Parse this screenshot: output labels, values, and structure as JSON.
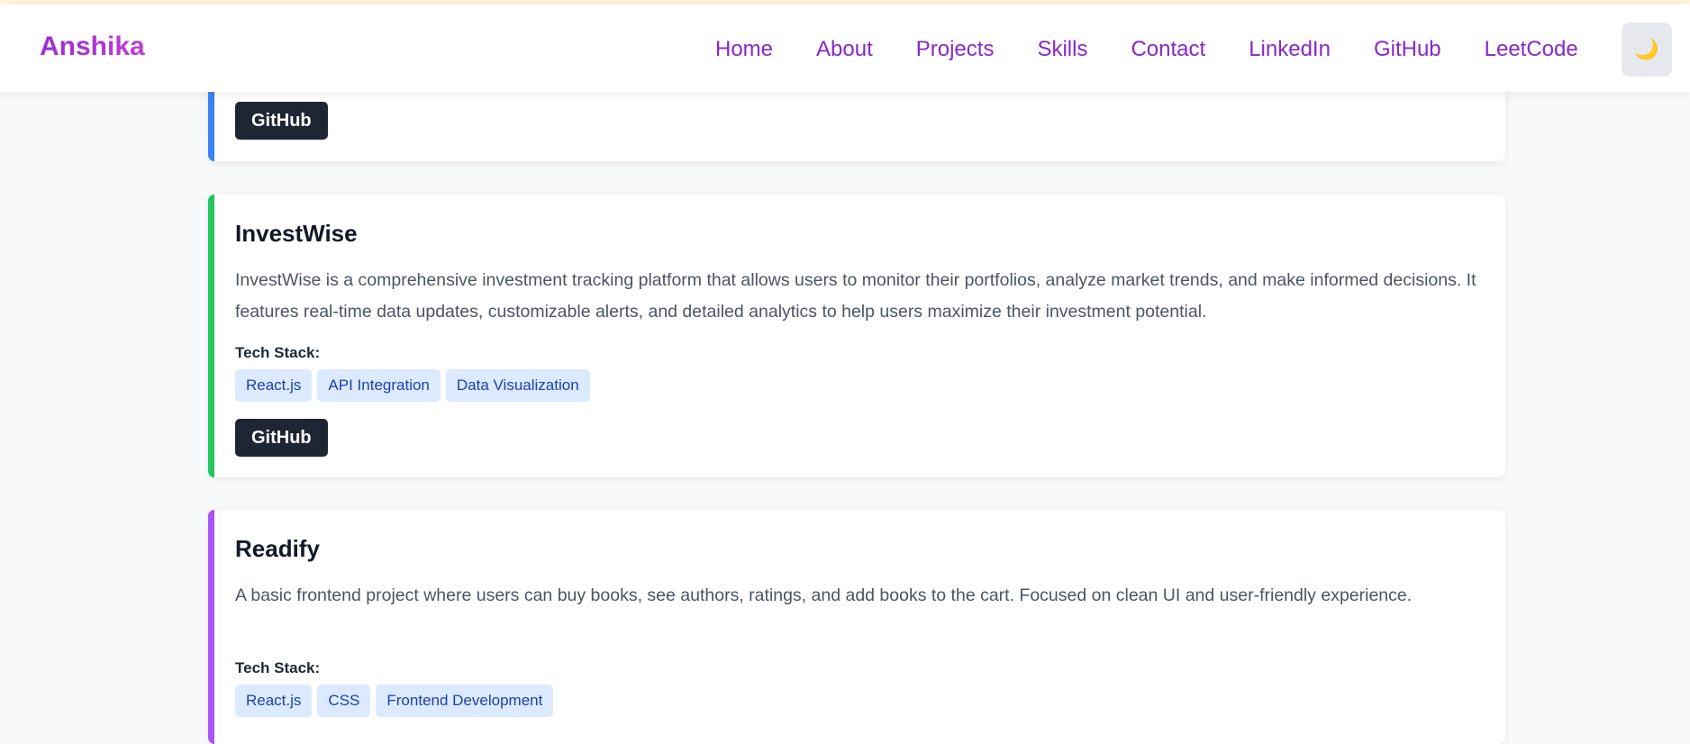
{
  "navbar": {
    "brand": "Anshika",
    "links": [
      "Home",
      "About",
      "Projects",
      "Skills",
      "Contact",
      "LinkedIn",
      "GitHub",
      "LeetCode"
    ],
    "theme_toggle_icon": "🌙"
  },
  "colors": {
    "brand": "#9b2fd1",
    "nav_link": "#8a27c9",
    "card_1_accent": "#3b82f6",
    "card_2_accent": "#22c55e",
    "card_3_accent": "#a855f7",
    "tag_bg": "#dbeafe",
    "tag_text": "#1e40af",
    "button_bg": "#1e2533"
  },
  "projects": [
    {
      "button_label": "GitHub"
    },
    {
      "title": "InvestWise",
      "description": "InvestWise is a comprehensive investment tracking platform that allows users to monitor their portfolios, analyze market trends, and make informed decisions. It features real-time data updates, customizable alerts, and detailed analytics to help users maximize their investment potential.",
      "tech_label": "Tech Stack:",
      "tech": [
        "React.js",
        "API Integration",
        "Data Visualization"
      ],
      "button_label": "GitHub"
    },
    {
      "title": "Readify",
      "description": "A basic frontend project where users can buy books, see authors, ratings, and add books to the cart. Focused on clean UI and user-friendly experience.",
      "tech_label": "Tech Stack:",
      "tech": [
        "React.js",
        "CSS",
        "Frontend Development"
      ]
    }
  ]
}
